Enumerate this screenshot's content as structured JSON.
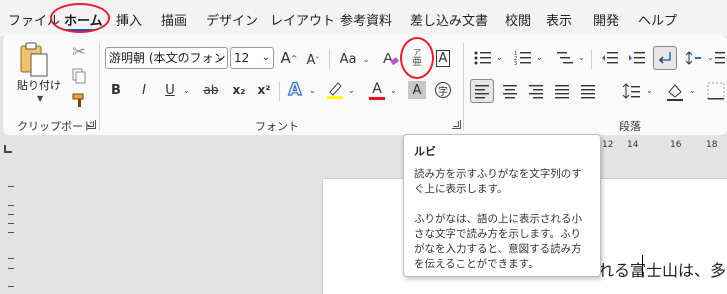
{
  "tabs": [
    "ファイル",
    "ホーム",
    "挿入",
    "描画",
    "デザイン",
    "レイアウト",
    "参考資料",
    "差し込み文書",
    "校閲",
    "表示",
    "開発",
    "ヘルプ"
  ],
  "active_tab": "ホーム",
  "clipboard": {
    "paste_label": "貼り付け",
    "group_label": "クリップボード"
  },
  "font": {
    "font_name": "游明朝 (本文のフォン",
    "font_size": "12",
    "group_label": "フォント",
    "grow_glyph": "A",
    "shrink_glyph": "A",
    "case_glyph": "Aa",
    "bold": "B",
    "italic": "I",
    "underline": "U",
    "strike": "ab",
    "subscript": "x₂",
    "superscript": "x²",
    "text_effect_glyph": "A",
    "font_color_glyph": "A",
    "char_shading_glyph": "A",
    "char_border_glyph": "A",
    "enclose_glyph": "字",
    "ruby_top": "ア",
    "ruby_bottom": "亜"
  },
  "paragraph": {
    "group_label": "段落"
  },
  "colors": {
    "accent": "#185abd",
    "highlight_red": "#e4202b",
    "font_color_bar": "#e81123",
    "highlighter_bar": "#ffff00"
  },
  "ruler": {
    "numbers": [
      "12",
      "14",
      "16",
      "18"
    ]
  },
  "tooltip": {
    "title": "ルビ",
    "body": "読み方を示すふりがなを文字列のすぐ上に表示します。\n\nふりがなは、語の上に表示される小さな文字で読み方を示します。ふりがなを入力すると、意図する読み方を伝えることができます。"
  },
  "document": {
    "visible_text": "れる富士山は、多"
  }
}
